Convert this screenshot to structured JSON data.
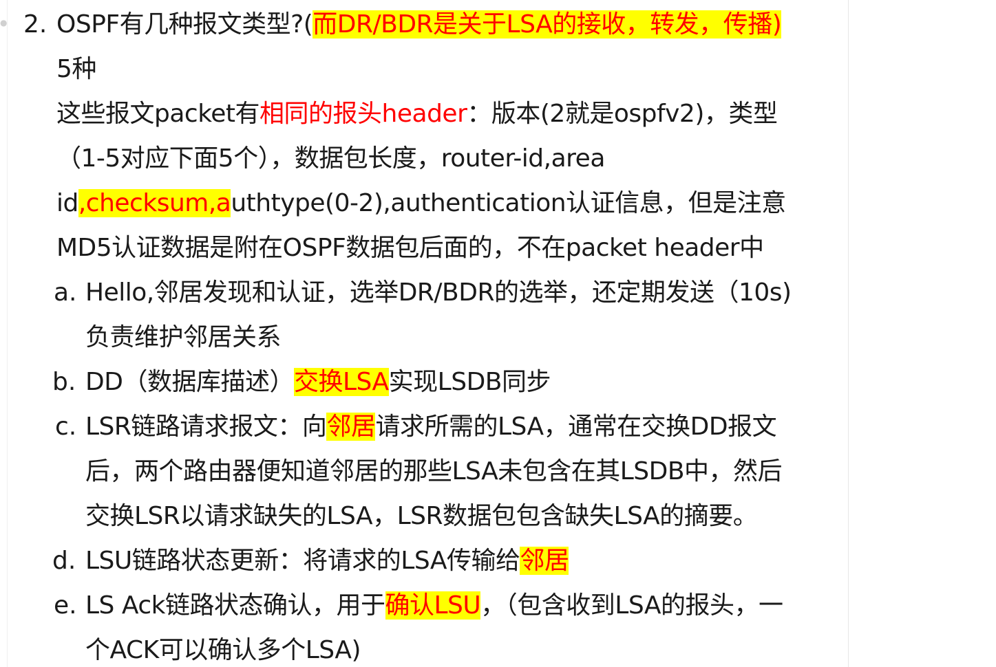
{
  "item": {
    "number": "2.",
    "title": "OSPF有几种报文类型?(",
    "title_note": "而DR/BDR是关于LSA的接收，转发，传播)"
  },
  "paragraph": {
    "count": "5种",
    "l3_a": "这些报文packet有",
    "l3_b": "相同的报头header",
    "l3_c": "：版本(2就是ospfv2)，类型",
    "l4": "（1-5对应下面5个），数据包长度，router-id,area",
    "l5_a": "id",
    "l5_b": ",checksum,a",
    "l5_c": "uthtype(0-2),authentication认证信息，但是注意",
    "l6": "MD5认证数据是附在OSPF数据包后面的，不在packet header中"
  },
  "list": {
    "a": {
      "marker": "a.",
      "l1": "Hello,邻居发现和认证，选举DR/BDR的选举，还定期发送（10s)",
      "l2": "负责维护邻居关系"
    },
    "b": {
      "marker": "b.",
      "l1_a": "DD（数据库描述）",
      "l1_b": "交换LSA",
      "l1_c": "实现LSDB同步"
    },
    "c": {
      "marker": "c.",
      "l1_a": "LSR链路请求报文：向",
      "l1_b": "邻居",
      "l1_c": "请求所需的LSA，通常在交换DD报文",
      "l2": "后，两个路由器便知道邻居的那些LSA未包含在其LSDB中，然后",
      "l3": "交换LSR以请求缺失的LSA，LSR数据包包含缺失LSA的摘要。"
    },
    "d": {
      "marker": "d.",
      "l1_a": "LSU链路状态更新：将请求的LSA传输给",
      "l1_b": "邻居"
    },
    "e": {
      "marker": "e.",
      "l1_a": "LS Ack链路状态确认，用于",
      "l1_b": "确认LSU",
      "l1_c": "，（包含收到LSA的报头，一",
      "l2": "个ACK可以确认多个LSA)"
    }
  },
  "colors": {
    "highlight": "#ffff00",
    "emphasis_text": "#ff0000",
    "body_text": "#1a1a1a"
  }
}
